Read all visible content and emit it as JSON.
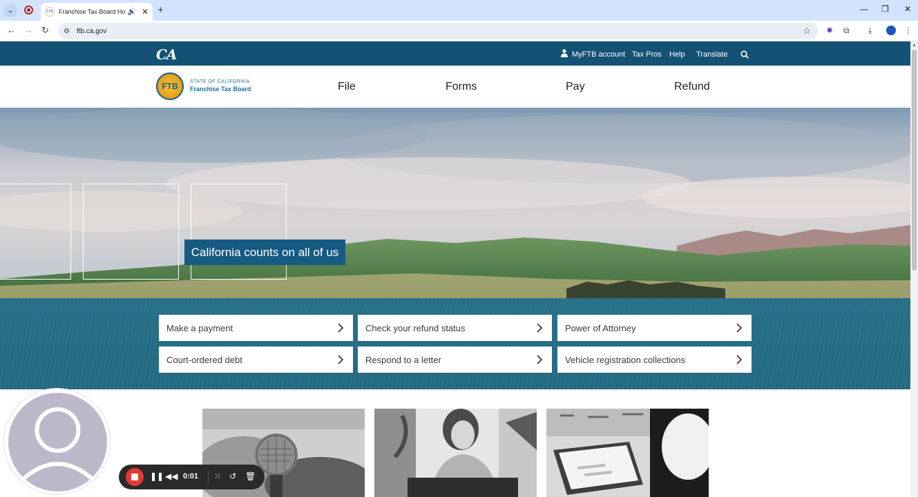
{
  "browser": {
    "tab_title": "Franchise Tax Board Homepage",
    "favicon_text": "FTB",
    "url": "ftb.ca.gov",
    "icons": [
      "tab-search-icon",
      "record-icon",
      "audio-icon",
      "close-icon",
      "new-tab-icon",
      "back-icon",
      "forward-icon",
      "reload-icon",
      "site-info-icon",
      "bookmark-star-icon",
      "extension-icon",
      "puzzle-icon",
      "download-icon",
      "profile-icon",
      "menu-icon"
    ]
  },
  "site": {
    "logo_text": "CA",
    "utility_links": [
      "MyFTB account",
      "Tax Pros",
      "Help",
      "Translate"
    ],
    "agency_state": "STATE OF CALIFORNIA",
    "agency_name": "Franchise Tax Board",
    "seal_text": "FTB",
    "main_nav": [
      "File",
      "Forms",
      "Pay",
      "Refund"
    ],
    "hero_tagline": "California counts on all of us",
    "quick_links": [
      "Make a payment",
      "Check your refund status",
      "Power of Attorney",
      "Court-ordered debt",
      "Respond to a letter",
      "Vehicle registration collections"
    ]
  },
  "recorder": {
    "time": "0:01"
  },
  "colors": {
    "header_blue": "#145275",
    "tagline_bg": "#165a82",
    "browser_tabbar": "#d3e3fd",
    "recorder_stop": "#e03c32"
  }
}
